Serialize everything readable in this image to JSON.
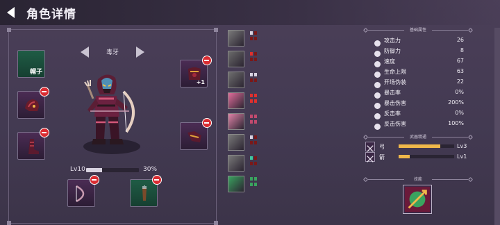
{
  "header": {
    "title": "角色详情"
  },
  "character": {
    "name": "毒牙",
    "level_label": "Lv10",
    "exp_percent_label": "30%",
    "exp_fraction": 0.3
  },
  "equipment": {
    "hat_slot_label": "帽子",
    "slot_upgrade_label": "+1"
  },
  "skill_icons": [
    {
      "name": "mask-skill-icon",
      "color": "#7a7a7a",
      "pips": [
        "#d8d3e0",
        "#7a1818",
        "#7a1818",
        "#7a1818"
      ]
    },
    {
      "name": "scope-skill-icon",
      "color": "#6b6b6b",
      "pips": [
        "#e0302e",
        "#7a1818",
        "#7a1818",
        "#7a1818"
      ]
    },
    {
      "name": "shadow-skill-icon",
      "color": "#6f6f6f",
      "pips": [
        "#d8d3e0",
        "#d8d3e0",
        "#7a1818",
        "#7a1818"
      ]
    },
    {
      "name": "claw-skill-icon",
      "color": "#e06d9b",
      "pips": [
        "#e0302e",
        "#e0302e",
        "#e0302e",
        "#e0302e"
      ]
    },
    {
      "name": "arrow-skill-icon",
      "color": "#e084a8",
      "pips": [
        "#c14a6e",
        "#c14a6e",
        "#c14a6e",
        "#c14a6e"
      ]
    },
    {
      "name": "blade-skill-icon",
      "color": "#7a7a7a",
      "pips": [
        "#d8d3e0",
        "#7a1818",
        "#7a1818",
        "#7a1818"
      ]
    },
    {
      "name": "beast-skill-icon",
      "color": "#7a7a7a",
      "pips": [
        "#3fc7a0",
        "#7a1818",
        "#7a1818",
        "#7a1818"
      ]
    },
    {
      "name": "grass-skill-icon",
      "color": "#3aa35f",
      "pips": [
        "#3aa35f",
        "#3aa35f",
        "#3aa35f",
        "#3aa35f"
      ]
    }
  ],
  "attributes": {
    "heading": "基础属性",
    "rows": [
      {
        "label": "攻击力",
        "value": "26",
        "icon": "sword-icon"
      },
      {
        "label": "防御力",
        "value": "8",
        "icon": "shield-icon"
      },
      {
        "label": "速度",
        "value": "67",
        "icon": "boot-icon"
      },
      {
        "label": "生命上限",
        "value": "63",
        "icon": "heart-icon"
      },
      {
        "label": "开场伪装",
        "value": "22",
        "icon": "skull-icon"
      },
      {
        "label": "暴击率",
        "value": "0%",
        "icon": "crit-rate-icon"
      },
      {
        "label": "暴击伤害",
        "value": "200%",
        "icon": "crit-damage-icon"
      },
      {
        "label": "反击率",
        "value": "0%",
        "icon": "counter-rate-icon"
      },
      {
        "label": "反击伤害",
        "value": "100%",
        "icon": "counter-damage-icon"
      }
    ]
  },
  "weapon_mastery": {
    "heading": "武器精通",
    "rows": [
      {
        "name": "弓",
        "level": "Lv3",
        "fraction": 0.75
      },
      {
        "name": "箭",
        "level": "Lv1",
        "fraction": 0.2
      }
    ]
  },
  "skill": {
    "heading": "技能"
  },
  "colors": {
    "accent_bar": "#f0b84a",
    "remove_badge": "#d92c32"
  }
}
